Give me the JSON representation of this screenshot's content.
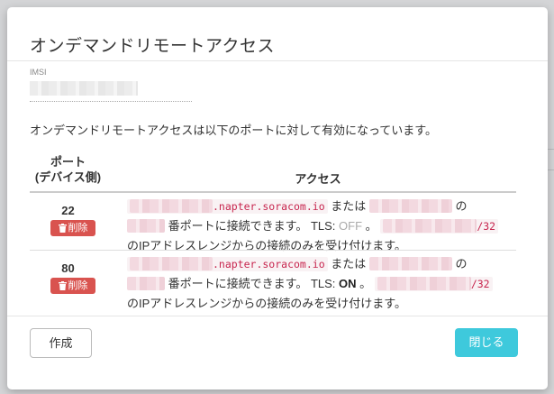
{
  "modal": {
    "title": "オンデマンドリモートアクセス",
    "imsi_label": "IMSI",
    "description": "オンデマンドリモートアクセスは以下のポートに対して有効になっています。",
    "table": {
      "header_port_line1": "ポート",
      "header_port_line2": "(デバイス側)",
      "header_access": "アクセス"
    },
    "rows": [
      {
        "port": "22",
        "delete_label": "削除",
        "host_suffix": ".napter.soracom.io",
        "or_text": "または",
        "no_text": "の",
        "port_text": "番ポートに接続できます。",
        "tls_label": "TLS:",
        "tls_value": "OFF",
        "tls_end": "。",
        "cidr_suffix": "/32",
        "restriction": "のIPアドレスレンジからの接続のみを受け付けます。"
      },
      {
        "port": "80",
        "delete_label": "削除",
        "host_suffix": ".napter.soracom.io",
        "or_text": "または",
        "no_text": "の",
        "port_text": "番ポートに接続できます。",
        "tls_label": "TLS:",
        "tls_value": "ON",
        "tls_end": "。",
        "cidr_suffix": "/32",
        "restriction": "のIPアドレスレンジからの接続のみを受け付けます。"
      }
    ],
    "buttons": {
      "create": "作成",
      "close": "閉じる"
    }
  },
  "colors": {
    "delete": "#d9534f",
    "close": "#3ec9dc",
    "code": "#c7254e"
  },
  "icons": [
    "trash-icon"
  ]
}
